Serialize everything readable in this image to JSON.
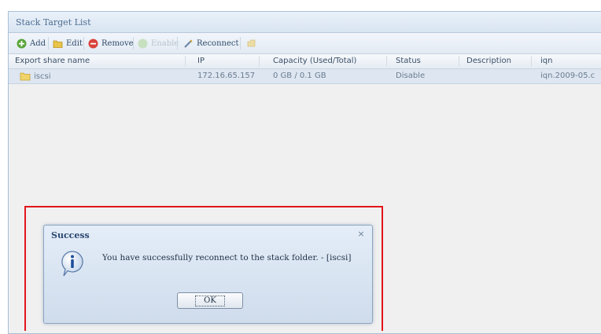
{
  "panel": {
    "title": "Stack Target List"
  },
  "toolbar": {
    "add_label": "Add",
    "edit_label": "Edit",
    "remove_label": "Remove",
    "enable_label": "Enable",
    "reconnect_label": "Reconnect",
    "add_icon": "plus-circle-icon",
    "edit_icon": "folder-edit-icon",
    "remove_icon": "minus-circle-icon",
    "enable_icon": "enable-icon",
    "reconnect_icon": "wand-icon",
    "extra_icon": "refresh-icon"
  },
  "table": {
    "headers": [
      "Export share name",
      "IP",
      "Capacity (Used/Total)",
      "Status",
      "Description",
      "iqn"
    ],
    "rows": [
      {
        "name": "iscsi",
        "ip": "172.16.65.157",
        "capacity": "0 GB / 0.1 GB",
        "status": "Disable",
        "description": "",
        "iqn": "iqn.2009-05.c"
      }
    ]
  },
  "dialog": {
    "title": "Success",
    "message": "You have successfully reconnect to the stack folder. - [iscsi]",
    "ok_label": "OK",
    "icon": "info-icon",
    "close_icon": "close-icon"
  },
  "colors": {
    "highlight": "#e3151b",
    "header_bg": "#d9e5f2",
    "row_selected": "#dde6f1"
  }
}
